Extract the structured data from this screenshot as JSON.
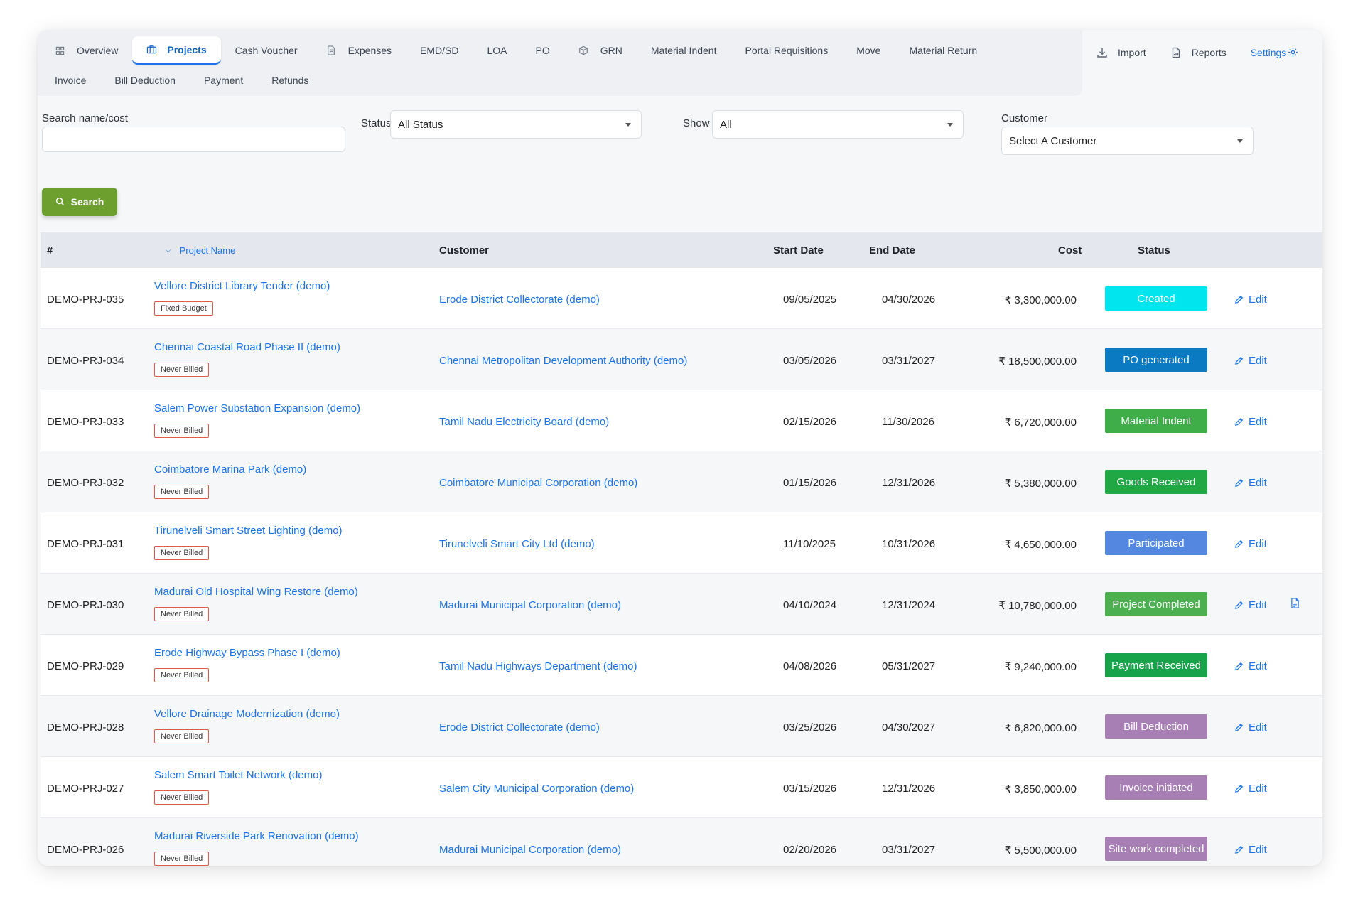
{
  "nav": {
    "row1": [
      {
        "label": "Overview",
        "icon": "grid-icon"
      },
      {
        "label": "Projects",
        "icon": "briefcase-icon",
        "active": true
      },
      {
        "label": "Cash Voucher",
        "icon": ""
      },
      {
        "label": "Expenses",
        "icon": "document-icon"
      },
      {
        "label": "EMD/SD",
        "icon": ""
      },
      {
        "label": "LOA",
        "icon": ""
      },
      {
        "label": "PO",
        "icon": ""
      },
      {
        "label": "GRN",
        "icon": "box-icon"
      },
      {
        "label": "Material Indent",
        "icon": ""
      },
      {
        "label": "Portal Requisitions",
        "icon": ""
      },
      {
        "label": "Move",
        "icon": ""
      },
      {
        "label": "Material Return",
        "icon": ""
      }
    ],
    "row2": [
      {
        "label": "Invoice"
      },
      {
        "label": "Bill Deduction"
      },
      {
        "label": "Payment"
      },
      {
        "label": "Refunds"
      }
    ]
  },
  "tools": {
    "import_label": "Import",
    "reports_label": "Reports",
    "settings_label": "Settings"
  },
  "filters": {
    "search_label": "Search name/cost",
    "search_value": "",
    "status_label": "Status",
    "status_value": "All Status",
    "show_label": "Show",
    "show_value": "All",
    "customer_label": "Customer",
    "customer_value": "Select A Customer",
    "search_button": "Search"
  },
  "table": {
    "headers": {
      "id": "#",
      "name": "Project Name",
      "customer": "Customer",
      "start": "Start Date",
      "end": "End Date",
      "cost": "Cost",
      "status": "Status"
    },
    "edit_label": "Edit",
    "rows": [
      {
        "id": "DEMO-PRJ-035",
        "name": "Vellore District Library Tender (demo)",
        "badge": "Fixed Budget",
        "customer": "Erode District Collectorate (demo)",
        "start": "09/05/2025",
        "end": "04/30/2026",
        "cost": "₹ 3,300,000.00",
        "status": "Created",
        "status_color": "#00e5ee",
        "doc": false
      },
      {
        "id": "DEMO-PRJ-034",
        "name": "Chennai Coastal Road Phase II (demo)",
        "badge": "Never Billed",
        "customer": "Chennai Metropolitan Development Authority (demo)",
        "start": "03/05/2026",
        "end": "03/31/2027",
        "cost": "₹ 18,500,000.00",
        "status": "PO generated",
        "status_color": "#0a7bc2",
        "doc": false
      },
      {
        "id": "DEMO-PRJ-033",
        "name": "Salem Power Substation Expansion (demo)",
        "badge": "Never Billed",
        "customer": "Tamil Nadu Electricity Board (demo)",
        "start": "02/15/2026",
        "end": "11/30/2026",
        "cost": "₹ 6,720,000.00",
        "status": "Material Indent",
        "status_color": "#3fae49",
        "doc": false
      },
      {
        "id": "DEMO-PRJ-032",
        "name": "Coimbatore Marina Park (demo)",
        "badge": "Never Billed",
        "customer": "Coimbatore Municipal Corporation (demo)",
        "start": "01/15/2026",
        "end": "12/31/2026",
        "cost": "₹ 5,380,000.00",
        "status": "Goods Received",
        "status_color": "#1fa844",
        "doc": false
      },
      {
        "id": "DEMO-PRJ-031",
        "name": "Tirunelveli Smart Street Lighting (demo)",
        "badge": "Never Billed",
        "customer": "Tirunelveli Smart City Ltd (demo)",
        "start": "11/10/2025",
        "end": "10/31/2026",
        "cost": "₹ 4,650,000.00",
        "status": "Participated",
        "status_color": "#5487e0",
        "doc": false
      },
      {
        "id": "DEMO-PRJ-030",
        "name": "Madurai Old Hospital Wing Restore (demo)",
        "badge": "Never Billed",
        "customer": "Madurai Municipal Corporation (demo)",
        "start": "04/10/2024",
        "end": "12/31/2024",
        "cost": "₹ 10,780,000.00",
        "status": "Project Completed",
        "status_color": "#4caf50",
        "doc": true
      },
      {
        "id": "DEMO-PRJ-029",
        "name": "Erode Highway Bypass Phase I (demo)",
        "badge": "Never Billed",
        "customer": "Tamil Nadu Highways Department (demo)",
        "start": "04/08/2026",
        "end": "05/31/2027",
        "cost": "₹ 9,240,000.00",
        "status": "Payment Received",
        "status_color": "#16a34a",
        "doc": false
      },
      {
        "id": "DEMO-PRJ-028",
        "name": "Vellore Drainage Modernization (demo)",
        "badge": "Never Billed",
        "customer": "Erode District Collectorate (demo)",
        "start": "03/25/2026",
        "end": "04/30/2027",
        "cost": "₹ 6,820,000.00",
        "status": "Bill Deduction",
        "status_color": "#a77fb5",
        "doc": false
      },
      {
        "id": "DEMO-PRJ-027",
        "name": "Salem Smart Toilet Network (demo)",
        "badge": "Never Billed",
        "customer": "Salem City Municipal Corporation (demo)",
        "start": "03/15/2026",
        "end": "12/31/2026",
        "cost": "₹ 3,850,000.00",
        "status": "Invoice initiated",
        "status_color": "#a77fb5",
        "doc": false
      },
      {
        "id": "DEMO-PRJ-026",
        "name": "Madurai Riverside Park Renovation (demo)",
        "badge": "Never Billed",
        "customer": "Madurai Municipal Corporation (demo)",
        "start": "02/20/2026",
        "end": "03/31/2027",
        "cost": "₹ 5,500,000.00",
        "status": "Site work completed",
        "status_color": "#a77fb5",
        "doc": false
      }
    ]
  }
}
